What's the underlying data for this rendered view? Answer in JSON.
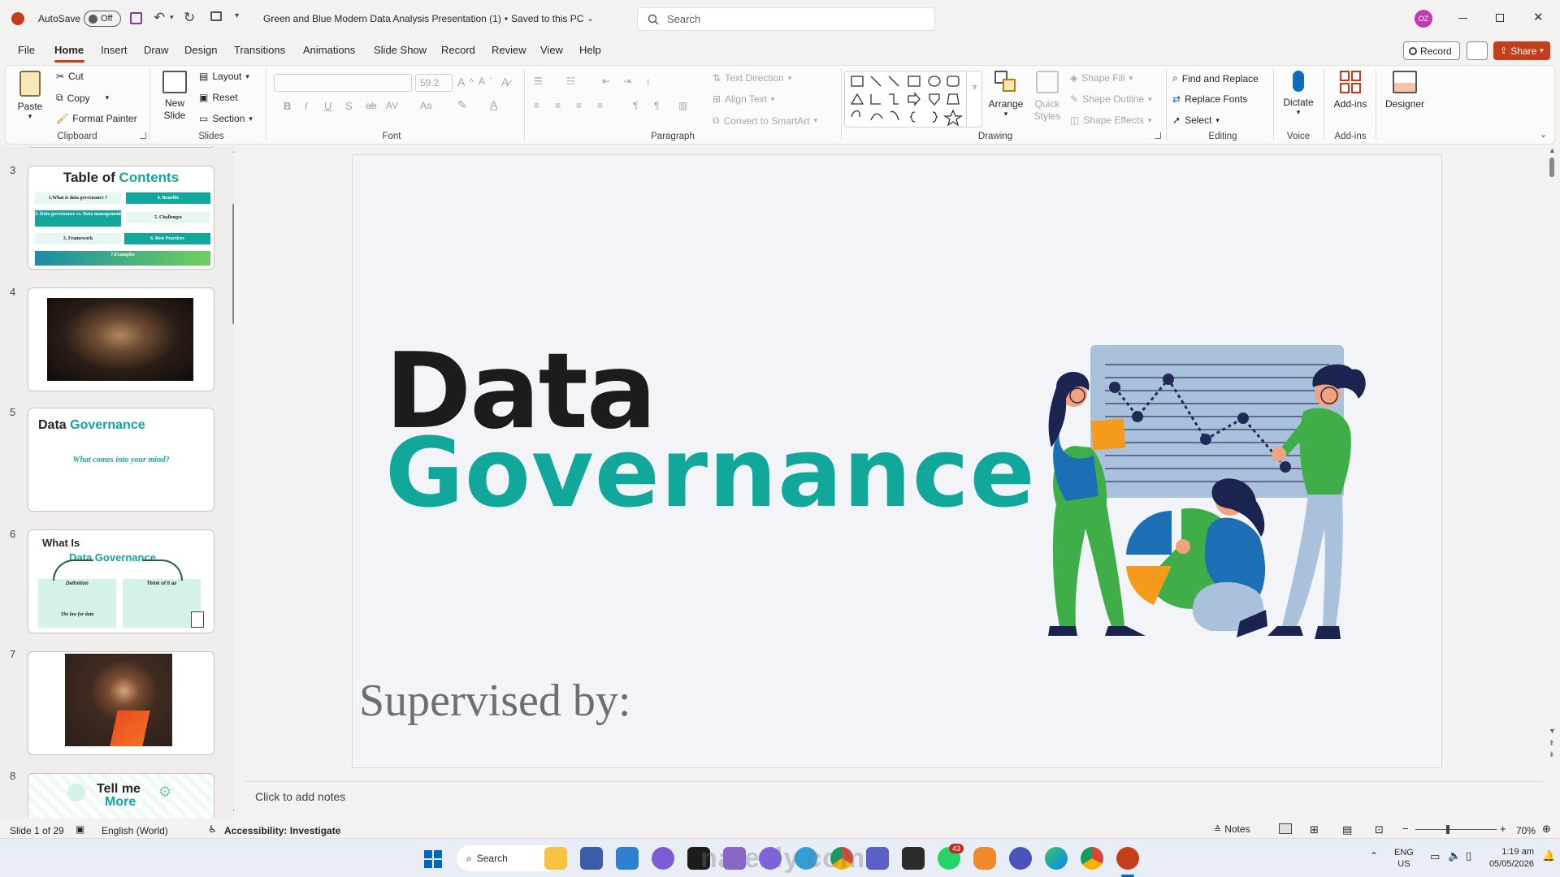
{
  "app": {
    "autosave_label": "AutoSave",
    "autosave_state": "Off",
    "doc_title": "Green and Blue Modern Data Analysis Presentation (1)",
    "save_status": "Saved to this PC",
    "search_placeholder": "Search",
    "user_initials": "OZ",
    "accent": "#c43e1c",
    "teal": "#12a79b"
  },
  "menu": {
    "tabs": [
      "File",
      "Home",
      "Insert",
      "Draw",
      "Design",
      "Transitions",
      "Animations",
      "Slide Show",
      "Record",
      "Review",
      "View",
      "Help"
    ],
    "record_button": "Record",
    "share_button": "Share"
  },
  "ribbon": {
    "clipboard": {
      "paste": "Paste",
      "cut": "Cut",
      "copy": "Copy",
      "format_painter": "Format Painter",
      "label": "Clipboard"
    },
    "slides": {
      "new_slide": "New Slide",
      "layout": "Layout",
      "reset": "Reset",
      "section": "Section",
      "label": "Slides"
    },
    "font": {
      "font_name": "",
      "font_size": "59.2",
      "label": "Font"
    },
    "paragraph": {
      "text_direction": "Text Direction",
      "align_text": "Align Text",
      "convert_smartart": "Convert to SmartArt",
      "label": "Paragraph"
    },
    "drawing": {
      "arrange": "Arrange",
      "quick_styles": "Quick Styles",
      "shape_fill": "Shape Fill",
      "shape_outline": "Shape Outline",
      "shape_effects": "Shape Effects",
      "label": "Drawing"
    },
    "editing": {
      "find_replace": "Find and Replace",
      "replace_fonts": "Replace Fonts",
      "select": "Select",
      "label": "Editing"
    },
    "voice": {
      "dictate": "Dictate",
      "label": "Voice"
    },
    "addins": {
      "addins": "Add-ins",
      "label": "Add-ins"
    },
    "designer": {
      "designer": "Designer"
    }
  },
  "thumbnails": [
    {
      "num": "3",
      "title_a": "Table of ",
      "title_b": "Contents",
      "items": [
        "1.What is data governance ?",
        "4. Benefits",
        "2. Data governance vs. Data management",
        "5. Challenges",
        "3. Framework",
        "6. Best Practices",
        "7.Examples"
      ]
    },
    {
      "num": "4"
    },
    {
      "num": "5",
      "title_a": "Data ",
      "title_b": "Governance",
      "subtitle": "What comes into your mind?"
    },
    {
      "num": "6",
      "title_a": "What Is",
      "title_b": "Data Governance",
      "col1": "Definition",
      "col2": "Think of it as",
      "footer": "The law for data"
    },
    {
      "num": "7"
    },
    {
      "num": "8",
      "title_a": "Tell me",
      "title_b": "More"
    }
  ],
  "slide": {
    "title_line1": "Data",
    "title_line2": "Governance",
    "supervised": "Supervised by:"
  },
  "notes_placeholder": "Click to add notes",
  "status": {
    "slide_count": "Slide 1 of 29",
    "language": "English (World)",
    "accessibility": "Accessibility: Investigate",
    "notes": "Notes",
    "zoom": "70%"
  },
  "taskbar": {
    "search": "Search",
    "lang": "ENG",
    "region": "US",
    "time": "1:19 am",
    "date": "05/05/2026",
    "badge": "43"
  },
  "watermark": {
    "text": "nafezly.com"
  }
}
